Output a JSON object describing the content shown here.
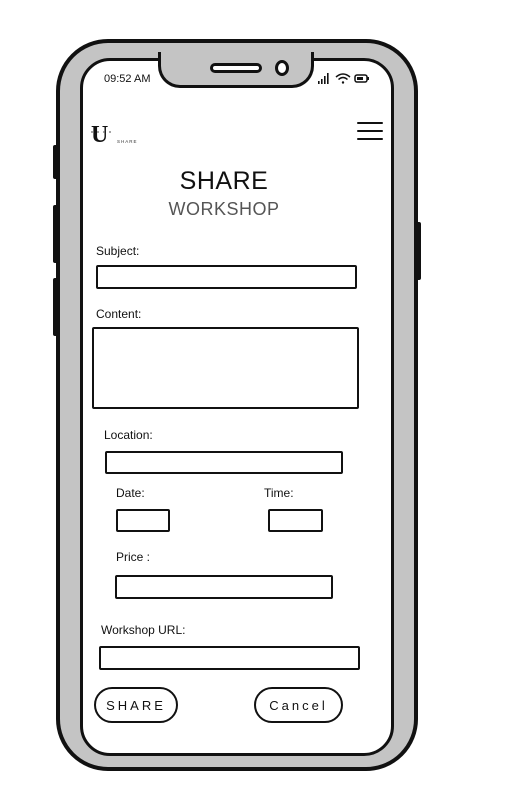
{
  "status": {
    "time": "09:52 AM"
  },
  "header": {
    "logo_letter": "U",
    "logo_word": "SHARE",
    "title": "SHARE",
    "subtitle": "WORKSHOP"
  },
  "form": {
    "subject": {
      "label": "Subject:",
      "value": ""
    },
    "content": {
      "label": "Content:",
      "value": ""
    },
    "location": {
      "label": "Location:",
      "value": ""
    },
    "date": {
      "label": "Date:",
      "value": ""
    },
    "time": {
      "label": "Time:",
      "value": ""
    },
    "price": {
      "label": "Price :",
      "value": ""
    },
    "workshop_url": {
      "label": "Workshop URL:",
      "value": ""
    }
  },
  "actions": {
    "share_label": "SHARE",
    "cancel_label": "Cancel"
  },
  "icons": {
    "menu": "hamburger-menu-icon",
    "signal": "signal-icon",
    "wifi": "wifi-icon",
    "battery": "battery-icon"
  },
  "colors": {
    "frame": "#c4c4c4",
    "ink": "#111111",
    "subtitle": "#555555"
  }
}
